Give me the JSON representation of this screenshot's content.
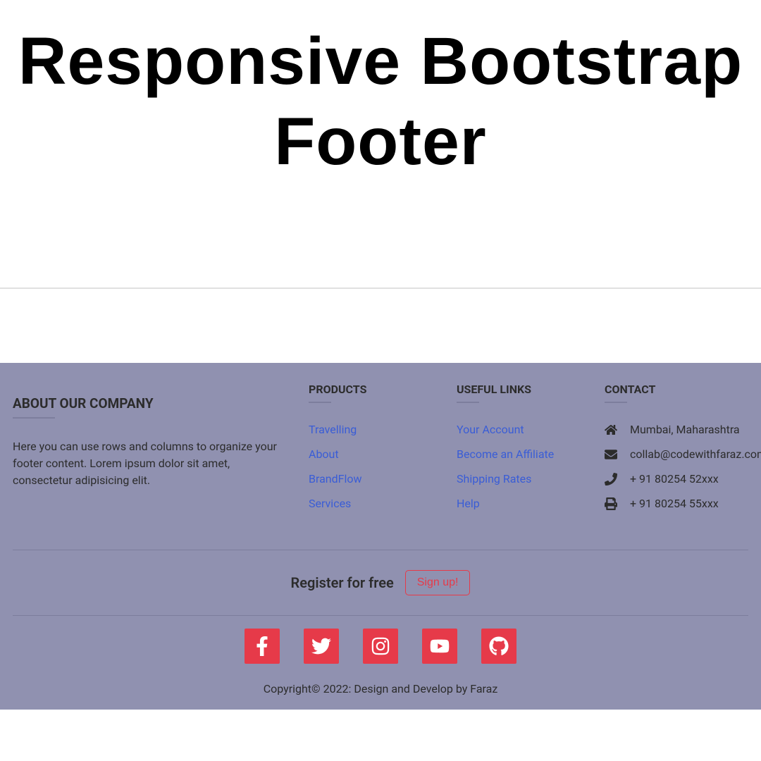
{
  "header": {
    "title": "Responsive Bootstrap Footer"
  },
  "footer": {
    "about": {
      "heading": "ABOUT OUR COMPANY",
      "text": "Here you can use rows and columns to organize your footer content. Lorem ipsum dolor sit amet, consectetur adipisicing elit."
    },
    "products": {
      "heading": "PRODUCTS",
      "links": [
        "Travelling",
        "About",
        "BrandFlow",
        "Services"
      ]
    },
    "useful": {
      "heading": "USEFUL LINKS",
      "links": [
        "Your Account",
        "Become an Affiliate",
        "Shipping Rates",
        "Help"
      ]
    },
    "contact": {
      "heading": "CONTACT",
      "address": "Mumbai, Maharashtra",
      "email": "collab@codewithfaraz.com",
      "phone": "+ 91 80254 52xxx",
      "fax": "+ 91 80254 55xxx"
    },
    "cta": {
      "text": "Register for free",
      "button": "Sign up!"
    },
    "copyright": "Copyright© 2022: Design and Develop by Faraz"
  }
}
